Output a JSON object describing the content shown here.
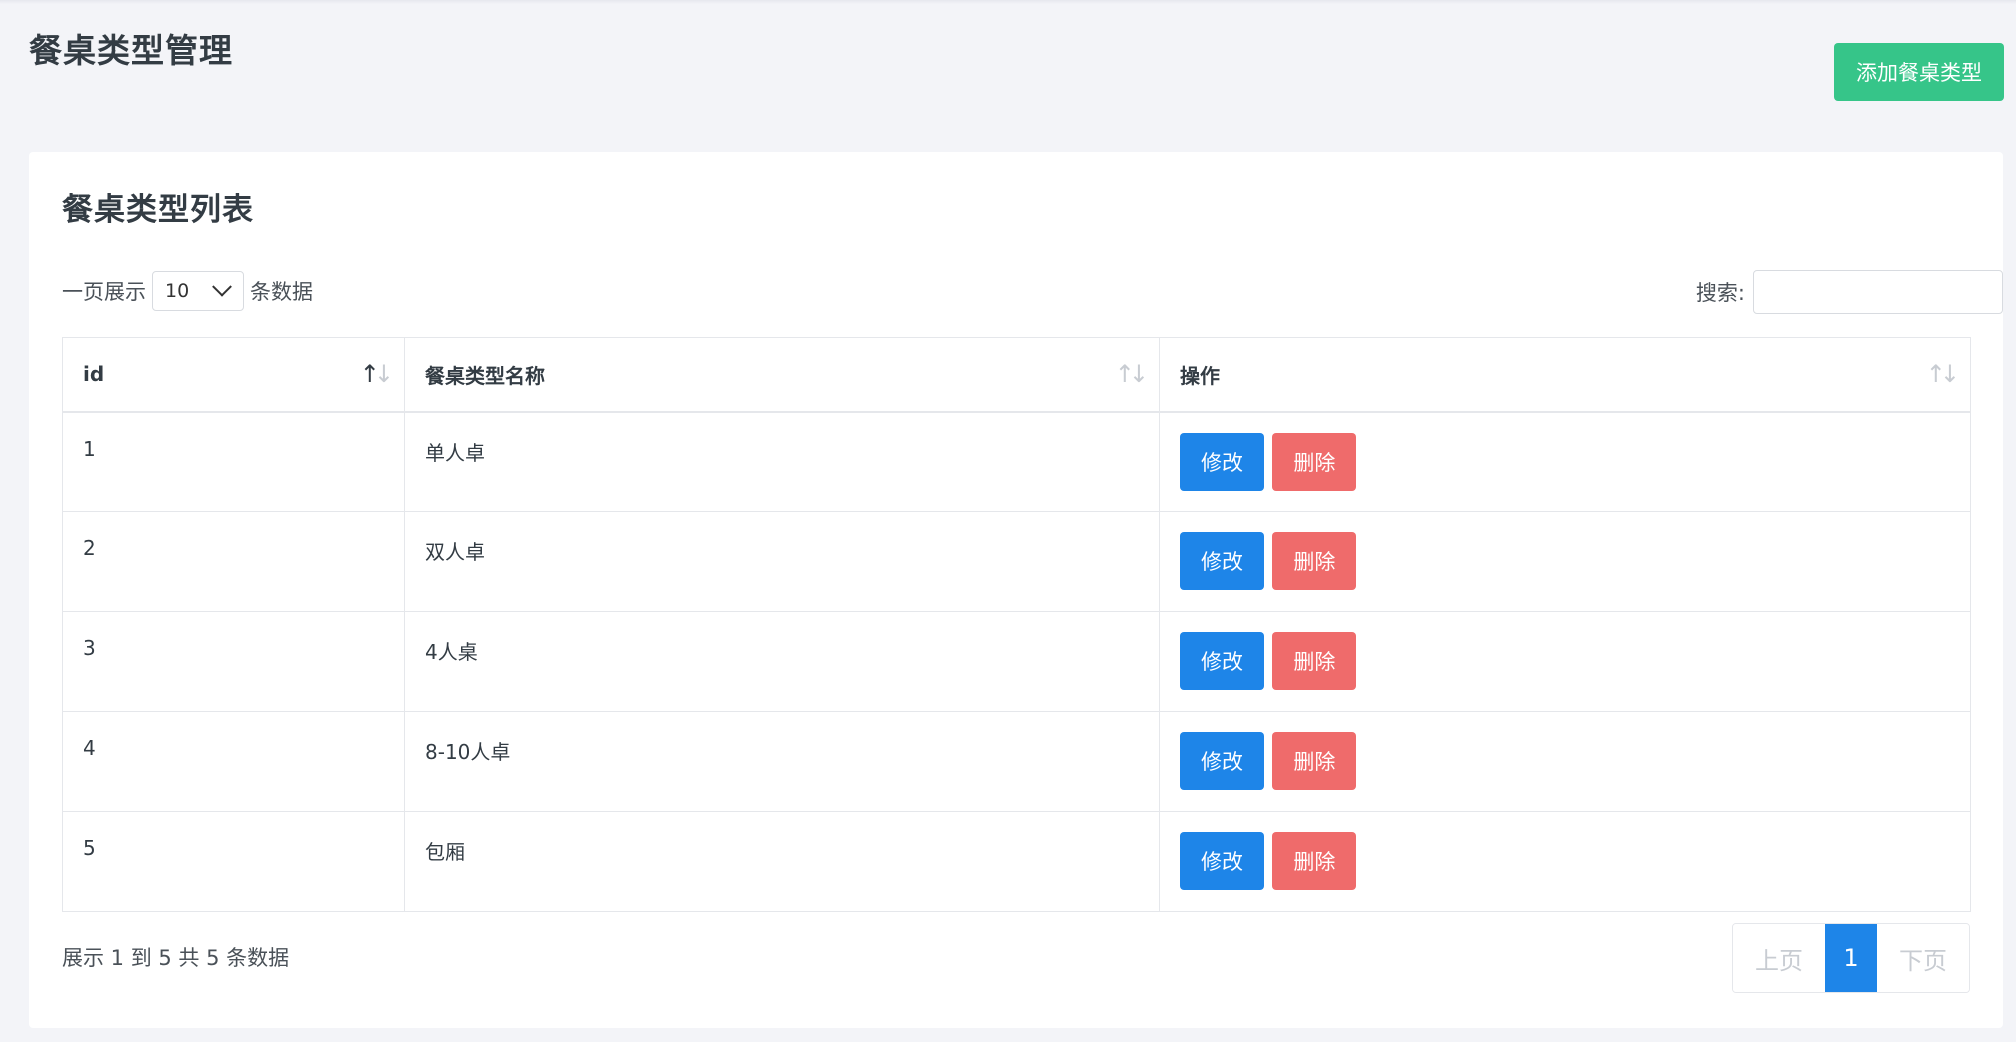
{
  "header": {
    "title": "餐桌类型管理",
    "add_button_label": "添加餐桌类型"
  },
  "card": {
    "title": "餐桌类型列表",
    "length_prefix": "一页展示",
    "length_value": "10",
    "length_suffix": "条数据",
    "search_label": "搜索:",
    "search_value": ""
  },
  "table": {
    "columns": [
      "id",
      "餐桌类型名称",
      "操作"
    ],
    "edit_label": "修改",
    "delete_label": "删除",
    "rows": [
      {
        "id": "1",
        "name": "单人卓"
      },
      {
        "id": "2",
        "name": "双人卓"
      },
      {
        "id": "3",
        "name": "4人桌"
      },
      {
        "id": "4",
        "name": "8-10人卓"
      },
      {
        "id": "5",
        "name": "包厢"
      }
    ]
  },
  "footer": {
    "info": "展示 1 到 5 共 5 条数据",
    "prev_label": "上页",
    "current_page": "1",
    "next_label": "下页"
  },
  "colors": {
    "add_button": "#36c589",
    "edit_button": "#1e85e8",
    "delete_button": "#ef6b6b",
    "current_page": "#1e85e8"
  }
}
